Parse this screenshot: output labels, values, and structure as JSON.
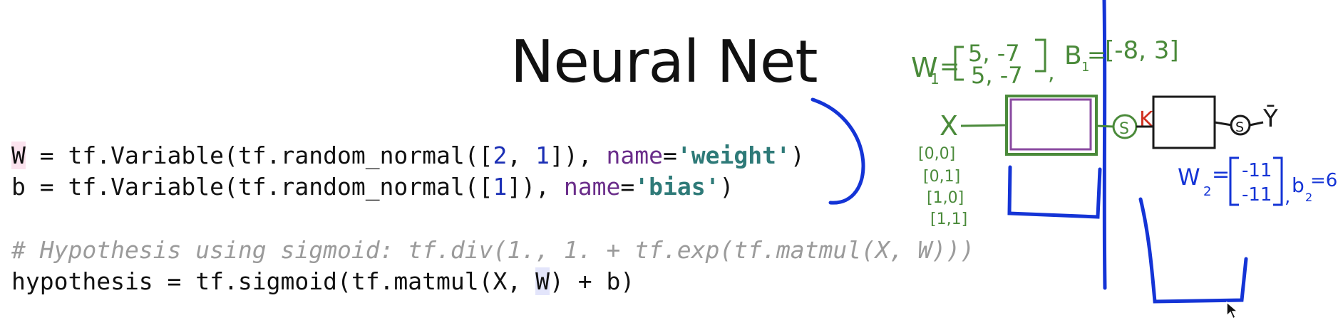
{
  "slide": {
    "title": "Neural Net"
  },
  "code": {
    "line1": {
      "var": "W",
      "pre": " = tf.Variable(tf.random_normal([",
      "n1": "2",
      "sep": ", ",
      "n2": "1",
      "mid": "]), ",
      "kw": "name",
      "eq": "=",
      "str": "'weight'",
      "end": ")"
    },
    "line2": {
      "pre": "b = tf.Variable(tf.random_normal([",
      "n1": "1",
      "mid": "]), ",
      "kw": "name",
      "eq": "=",
      "str": "'bias'",
      "end": ")"
    },
    "comment": "# Hypothesis using sigmoid: tf.div(1., 1. + tf.exp(tf.matmul(X, W)))",
    "line4": {
      "pre": "hypothesis = tf.sigmoid(tf.matmul(X, ",
      "hl": "W",
      "end": ") + b)"
    }
  },
  "annotations": {
    "w1_label": "W",
    "w1_sub": "1",
    "w1_eq": "=",
    "w1_row1": "5, -7",
    "w1_row2": "5, -7",
    "b1_label": "B",
    "b1_sub": "1",
    "b1_eq": "=",
    "b1_values": "[-8, 3]",
    "x_label": "X",
    "inputs": [
      "[0,0]",
      "[0,1]",
      "[1,0]",
      "[1,1]"
    ],
    "sigmoid1": "S",
    "k_label": "K",
    "sigmoid2": "S",
    "y_label": "Ȳ",
    "w2_label": "W",
    "w2_sub": "2",
    "w2_eq": "=",
    "w2_row1": "-11",
    "w2_row2": "-11",
    "b2_label": "b",
    "b2_sub": "2",
    "b2_value": "=6"
  },
  "colors": {
    "ink_green": "#4a8a3a",
    "ink_blue": "#1434d6",
    "ink_red": "#d03020",
    "ink_purple": "#8a4aa0",
    "ink_black": "#1a1a1a",
    "code_keyword": "#6a2d8a",
    "code_number": "#1b2fb5",
    "code_string": "#2e7a78",
    "code_comment": "#9b9b9b"
  },
  "icons": {
    "cursor": "mouse-pointer-icon"
  }
}
